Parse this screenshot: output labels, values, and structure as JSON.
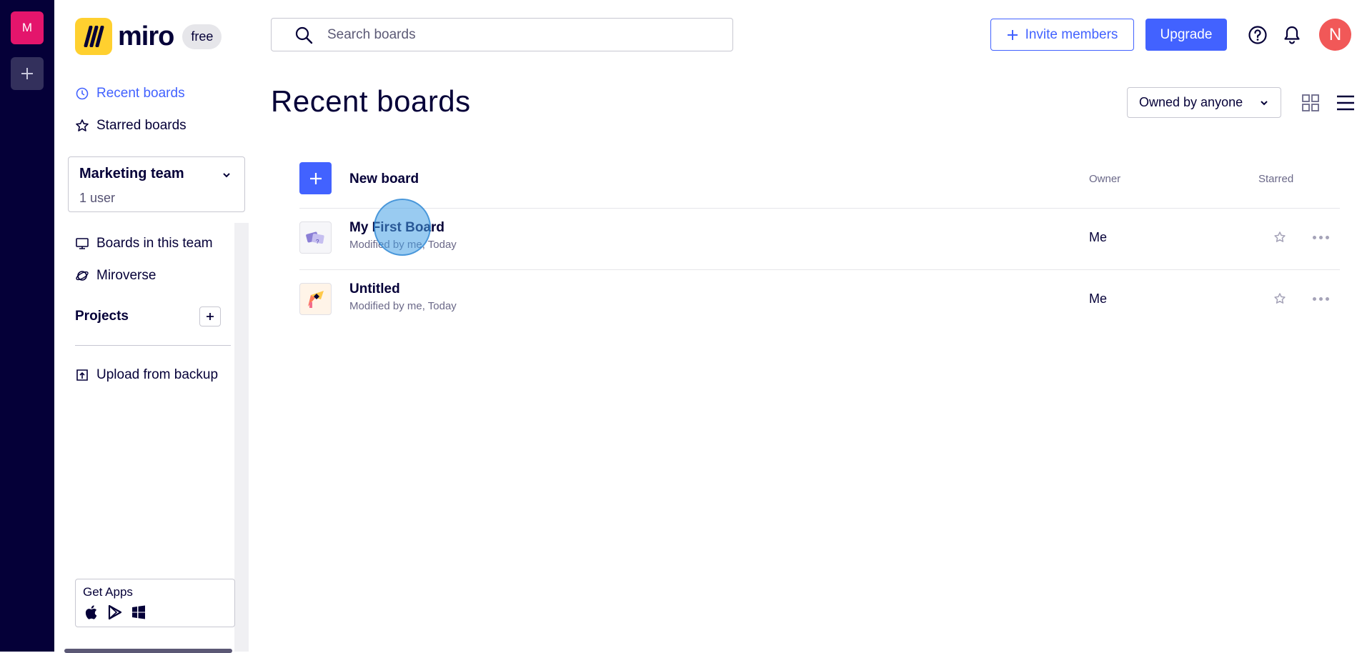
{
  "rail": {
    "team_initial": "M"
  },
  "logo": {
    "text": "miro",
    "plan": "free"
  },
  "sidebar": {
    "recent": "Recent boards",
    "starred": "Starred boards",
    "team": {
      "name": "Marketing team",
      "users": "1 user"
    },
    "boards_in_team": "Boards in this team",
    "miroverse": "Miroverse",
    "projects": "Projects",
    "upload": "Upload from backup",
    "get_apps": "Get Apps"
  },
  "topbar": {
    "search_placeholder": "Search boards",
    "invite": "Invite members",
    "upgrade": "Upgrade",
    "avatar_initial": "N"
  },
  "main": {
    "title": "Recent boards",
    "owner_filter": "Owned by anyone",
    "new_board": "New board",
    "col_owner": "Owner",
    "col_starred": "Starred",
    "boards": [
      {
        "name": "My First Board",
        "meta": "Modified by me, Today",
        "owner": "Me"
      },
      {
        "name": "Untitled",
        "meta": "Modified by me, Today",
        "owner": "Me"
      }
    ]
  },
  "colors": {
    "accent": "#4262ff",
    "rail": "#050038",
    "team": "#e4156c",
    "avatar": "#f15858",
    "logo": "#ffd02f"
  }
}
